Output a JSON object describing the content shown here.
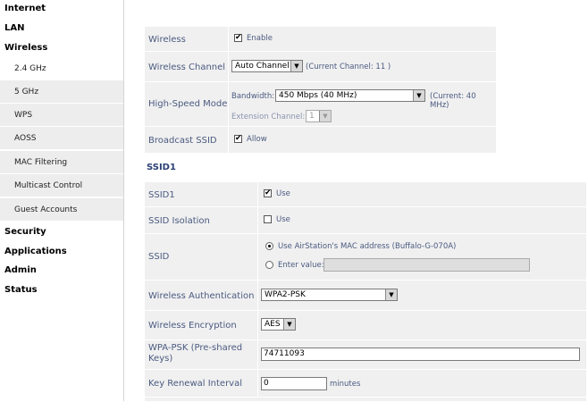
{
  "sidebar": {
    "internet": "Internet",
    "lan": "LAN",
    "wireless": "Wireless",
    "sub": [
      "2.4 GHz",
      "5 GHz",
      "WPS",
      "AOSS",
      "MAC Filtering",
      "Multicast Control",
      "Guest Accounts"
    ],
    "security": "Security",
    "applications": "Applications",
    "admin": "Admin",
    "status": "Status"
  },
  "basic": {
    "wireless_label": "Wireless",
    "wireless_value": "Enable",
    "wireless_checked": true,
    "channel_label": "Wireless Channel",
    "channel_value": "Auto Channel",
    "channel_current": "(Current Channel: 11 )",
    "hs_label": "High-Speed Mode",
    "bandwidth_label": "Bandwidth:",
    "bandwidth_value": "450 Mbps (40 MHz)",
    "bandwidth_current": "(Current: 40 MHz)",
    "extension_label": "Extension Channel:",
    "extension_value": "1",
    "broadcast_label": "Broadcast SSID",
    "broadcast_value": "Allow",
    "broadcast_checked": true
  },
  "ssid1_section": {
    "title": "SSID1",
    "ssid1_label": "SSID1",
    "ssid1_value": "Use",
    "ssid1_checked": true,
    "isolation_label": "SSID Isolation",
    "isolation_value": "Use",
    "isolation_checked": false,
    "ssid_label": "SSID",
    "ssid_opt1": "Use AirStation's MAC address (Buffalo-G-070A)",
    "ssid_opt2": "Enter value:",
    "ssid_enter_value": "",
    "auth_label": "Wireless Authentication",
    "auth_value": "WPA2-PSK",
    "enc_label": "Wireless Encryption",
    "enc_value": "AES",
    "psk_label": "WPA-PSK (Pre-shared Keys)",
    "psk_value": "74711093",
    "renew_label": "Key Renewal Interval",
    "renew_value": "0",
    "renew_unit": "minutes"
  },
  "colors": {
    "label_text": "#4a5a80",
    "row_bg": "#f0f0f0",
    "section_title": "#2b3f73"
  }
}
